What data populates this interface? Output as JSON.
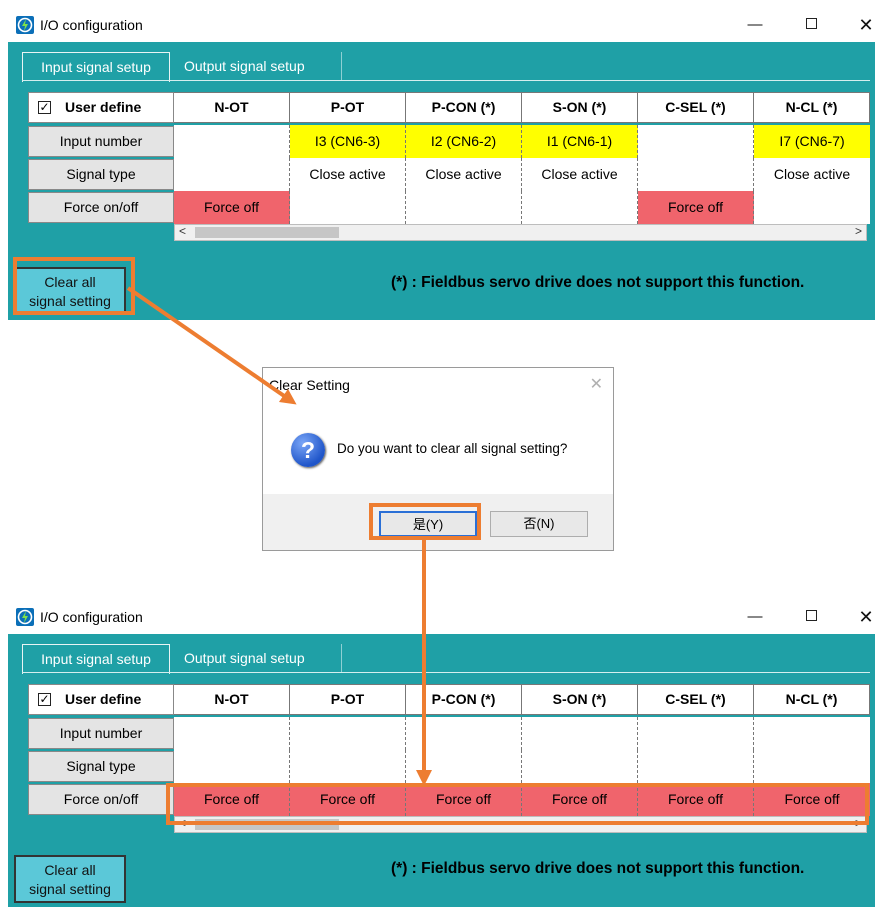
{
  "window_top": {
    "title": "I/O configuration",
    "tabs": {
      "input": "Input signal setup",
      "output": "Output signal setup"
    },
    "user_define": "User define",
    "checkbox_mark": "☑",
    "columns": [
      "N-OT",
      "P-OT",
      "P-CON (*)",
      "S-ON (*)",
      "C-SEL (*)",
      "N-CL (*)"
    ],
    "rows": {
      "input_number": "Input number",
      "signal_type": "Signal type",
      "force": "Force on/off"
    },
    "input_numbers": [
      "",
      "I3 (CN6-3)",
      "I2 (CN6-2)",
      "I1 (CN6-1)",
      "",
      "I7 (CN6-7)"
    ],
    "signal_types": [
      "",
      "Close active",
      "Close active",
      "Close active",
      "",
      "Close active"
    ],
    "force": [
      "Force off",
      "",
      "",
      "",
      "Force off",
      ""
    ],
    "clear_btn_line1": "Clear all",
    "clear_btn_line2": "signal setting",
    "note": "(*) : Fieldbus servo drive does not support this function."
  },
  "dialog": {
    "title": "Clear Setting",
    "message": "Do you want to clear all signal setting?",
    "yes": "是(Y)",
    "no": "否(N)"
  },
  "window_bottom": {
    "title": "I/O configuration",
    "tabs": {
      "input": "Input signal setup",
      "output": "Output signal setup"
    },
    "user_define": "User define",
    "columns": [
      "N-OT",
      "P-OT",
      "P-CON (*)",
      "S-ON (*)",
      "C-SEL (*)",
      "N-CL (*)"
    ],
    "rows": {
      "input_number": "Input number",
      "signal_type": "Signal type",
      "force": "Force on/off"
    },
    "force": [
      "Force off",
      "Force off",
      "Force off",
      "Force off",
      "Force off",
      "Force off"
    ],
    "clear_btn_line1": "Clear all",
    "clear_btn_line2": "signal setting",
    "note": "(*) : Fieldbus servo drive does not support this function."
  },
  "colors": {
    "teal": "#1fa0a6",
    "highlight": "#ed7d31",
    "yellow": "#ffff00",
    "force_red": "#f0646c",
    "button": "#5bc8d8"
  }
}
